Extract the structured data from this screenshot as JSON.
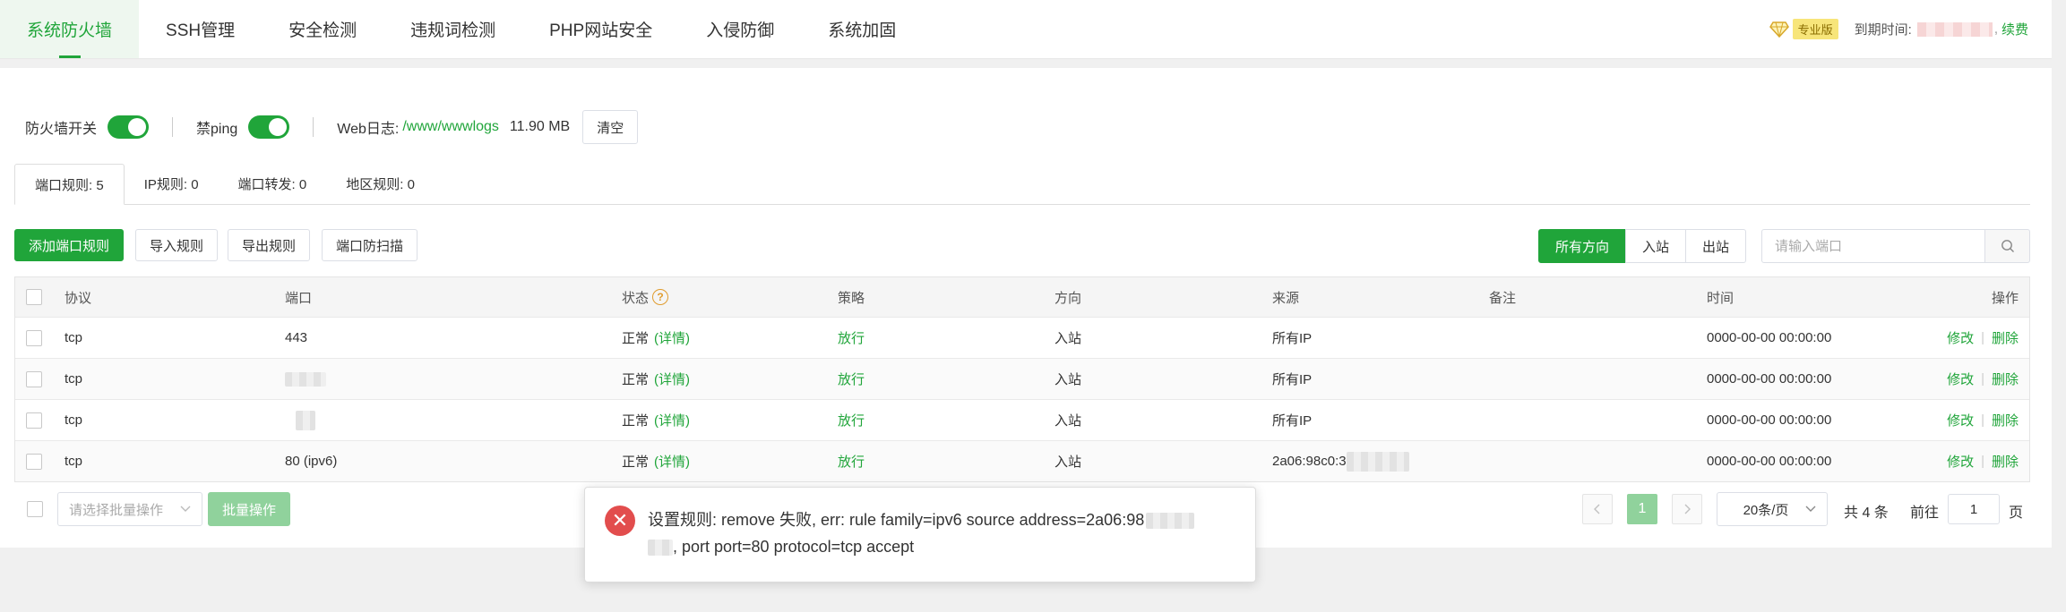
{
  "nav": {
    "tabs": [
      "系统防火墙",
      "SSH管理",
      "安全检测",
      "违规词检测",
      "PHP网站安全",
      "入侵防御",
      "系统加固"
    ],
    "active_tab": "系统防火墙",
    "pro_badge": "专业版",
    "expire_label": "到期时间:",
    "renew": "续费"
  },
  "switches": {
    "firewall_label": "防火墙开关",
    "firewall_on": true,
    "noping_label": "禁ping",
    "noping_on": true,
    "weblog_label": "Web日志:",
    "weblog_path": "/www/wwwlogs",
    "weblog_size": "11.90 MB",
    "clear_button": "清空"
  },
  "rule_tabs": [
    {
      "label": "端口规则: 5"
    },
    {
      "label": "IP规则: 0"
    },
    {
      "label": "端口转发: 0"
    },
    {
      "label": "地区规则: 0"
    }
  ],
  "toolbar": {
    "add_button": "添加端口规则",
    "import_button": "导入规则",
    "export_button": "导出规则",
    "scan_button": "端口防扫描",
    "direction_all": "所有方向",
    "direction_in": "入站",
    "direction_out": "出站",
    "search_placeholder": "请输入端口"
  },
  "table": {
    "columns": {
      "protocol": "协议",
      "port": "端口",
      "status": "状态",
      "policy": "策略",
      "direction": "方向",
      "source": "来源",
      "remark": "备注",
      "time": "时间",
      "action": "操作"
    },
    "rows": [
      {
        "protocol": "tcp",
        "port": "443",
        "status": "正常",
        "detail": "(详情)",
        "policy": "放行",
        "direction": "入站",
        "source": "所有IP",
        "remark": "",
        "time": "0000-00-00 00:00:00",
        "edit": "修改",
        "delete": "删除"
      },
      {
        "protocol": "tcp",
        "port": "",
        "status": "正常",
        "detail": "(详情)",
        "policy": "放行",
        "direction": "入站",
        "source": "所有IP",
        "remark": "",
        "time": "0000-00-00 00:00:00",
        "edit": "修改",
        "delete": "删除"
      },
      {
        "protocol": "tcp",
        "port": "",
        "status": "正常",
        "detail": "(详情)",
        "policy": "放行",
        "direction": "入站",
        "source": "所有IP",
        "remark": "",
        "time": "0000-00-00 00:00:00",
        "edit": "修改",
        "delete": "删除"
      },
      {
        "protocol": "tcp",
        "port": "80 (ipv6)",
        "status": "正常",
        "detail": "(详情)",
        "policy": "放行",
        "direction": "入站",
        "source": "2a06:98c0:3",
        "remark": "",
        "time": "0000-00-00 00:00:00",
        "edit": "修改",
        "delete": "删除"
      }
    ]
  },
  "footer": {
    "batch_placeholder": "请选择批量操作",
    "batch_button": "批量操作",
    "current_page": "1",
    "page_size": "20条/页",
    "total": "共 4 条",
    "goto_label": "前往",
    "goto_value": "1",
    "goto_suffix": "页"
  },
  "toast": {
    "line1": "设置规则: remove 失败, err: rule family=ipv6 source address=2a06:98",
    "line2": ", port port=80 protocol=tcp accept"
  },
  "colors": {
    "accent": "#20a53a",
    "error": "#e24d4d",
    "warning": "#e09c2e",
    "pro_badge_bg": "#f7e57a"
  }
}
